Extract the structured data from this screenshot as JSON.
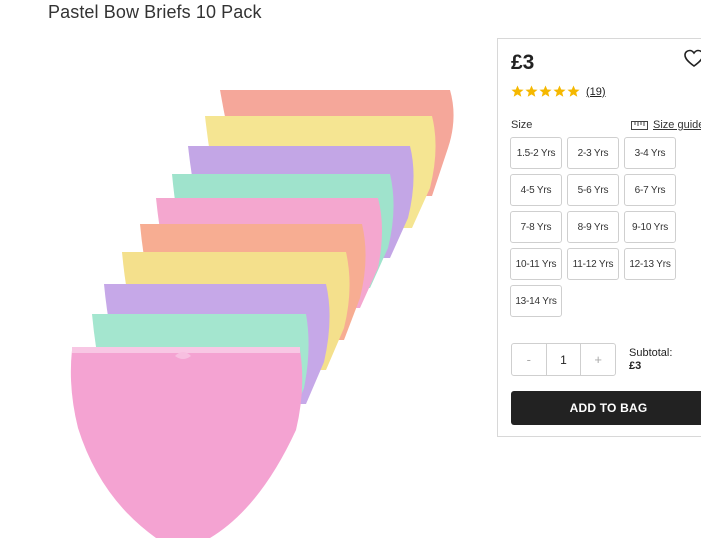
{
  "product": {
    "title": "Pastel Bow Briefs 10 Pack",
    "price": "£3",
    "rating_count": "(19)",
    "stars": 5
  },
  "sizes": {
    "label": "Size",
    "guide_label": "Size guide",
    "options": [
      "1.5-2 Yrs",
      "2-3 Yrs",
      "3-4 Yrs",
      "4-5 Yrs",
      "5-6 Yrs",
      "6-7 Yrs",
      "7-8 Yrs",
      "8-9 Yrs",
      "9-10 Yrs",
      "10-11 Yrs",
      "11-12 Yrs",
      "12-13 Yrs",
      "13-14 Yrs"
    ]
  },
  "quantity": {
    "minus": "-",
    "value": "1",
    "plus": "+"
  },
  "subtotal": {
    "label": "Subtotal:",
    "amount": "£3"
  },
  "add_to_bag": "ADD TO BAG",
  "colors": {
    "star": "#f5b800",
    "button": "#222222"
  }
}
